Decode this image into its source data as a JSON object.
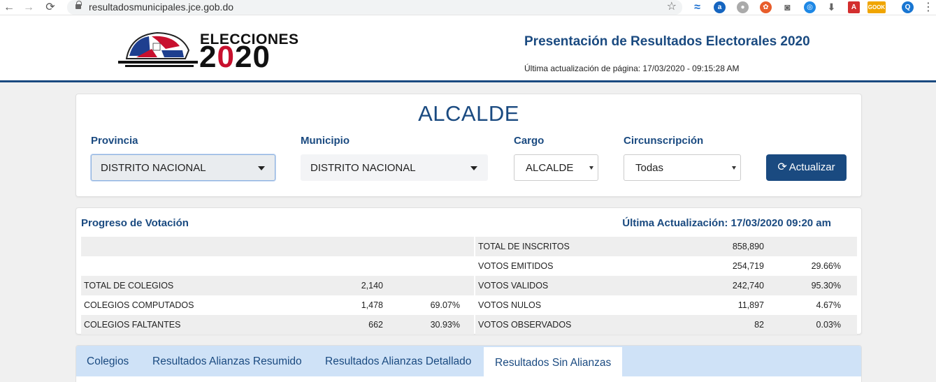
{
  "browser": {
    "url": "resultadosmunicipales.jce.gob.do",
    "back": "←",
    "forward": "→",
    "reload": "⟳"
  },
  "header": {
    "logo_word": "ELECCIONES",
    "logo_year_a": "2",
    "logo_year_b": "0",
    "logo_year_c": "2",
    "logo_year_d": "0",
    "title": "Presentación de Resultados Electorales 2020",
    "last_update": "Última actualización de página: 17/03/2020 - 09:15:28 AM"
  },
  "filters": {
    "cargo_title": "ALCALDE",
    "provincia_label": "Provincia",
    "provincia_value": "DISTRITO NACIONAL",
    "municipio_label": "Municipio",
    "municipio_value": "DISTRITO NACIONAL",
    "cargo_label": "Cargo",
    "cargo_value": "ALCALDE",
    "circ_label": "Circunscripción",
    "circ_value": "Todas",
    "update_button": "Actualizar"
  },
  "progress": {
    "title": "Progreso de Votación",
    "updated": "Última Actualización: 17/03/2020 09:20 am",
    "left_rows": [
      {
        "label": "",
        "value": "",
        "percent": ""
      },
      {
        "label": "",
        "value": "",
        "percent": ""
      },
      {
        "label": "TOTAL DE COLEGIOS",
        "value": "2,140",
        "percent": ""
      },
      {
        "label": "COLEGIOS COMPUTADOS",
        "value": "1,478",
        "percent": "69.07%"
      },
      {
        "label": "COLEGIOS FALTANTES",
        "value": "662",
        "percent": "30.93%"
      }
    ],
    "right_rows": [
      {
        "label": "TOTAL DE INSCRITOS",
        "value": "858,890",
        "percent": ""
      },
      {
        "label": "VOTOS EMITIDOS",
        "value": "254,719",
        "percent": "29.66%"
      },
      {
        "label": "VOTOS VALIDOS",
        "value": "242,740",
        "percent": "95.30%"
      },
      {
        "label": "VOTOS NULOS",
        "value": "11,897",
        "percent": "4.67%"
      },
      {
        "label": "VOTOS OBSERVADOS",
        "value": "82",
        "percent": "0.03%"
      }
    ]
  },
  "tabs": [
    {
      "label": "Colegios"
    },
    {
      "label": "Resultados Alianzas Resumido"
    },
    {
      "label": "Resultados Alianzas Detallado"
    },
    {
      "label": "Resultados Sin Alianzas"
    }
  ],
  "colors": {
    "primary": "#1a4a80",
    "tabbar": "#cfe2f7",
    "flag_red": "#c8102e",
    "flag_blue": "#1e3f8f"
  }
}
